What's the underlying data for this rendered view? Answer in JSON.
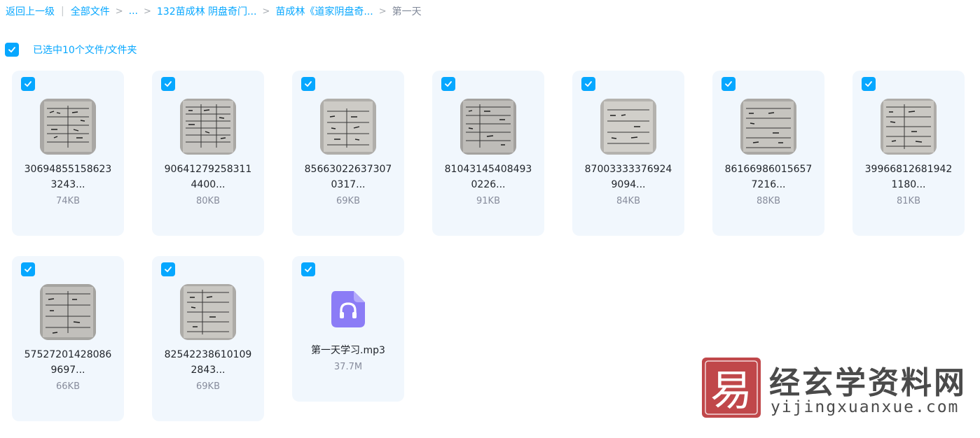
{
  "breadcrumb": {
    "back": "返回上一级",
    "divider": "|",
    "items": [
      "全部文件",
      "...",
      "132苗成林 阴盘奇门...",
      "苗成林《道家阴盘奇..."
    ],
    "separator": ">",
    "current": "第一天"
  },
  "selection": {
    "text": "已选中10个文件/文件夹",
    "checked": true
  },
  "files": [
    {
      "name_line1": "30694855158623",
      "name_line2": "3243...",
      "size": "74KB",
      "type": "image",
      "checked": true
    },
    {
      "name_line1": "90641279258311",
      "name_line2": "4400...",
      "size": "80KB",
      "type": "image",
      "checked": true
    },
    {
      "name_line1": "85663022637307",
      "name_line2": "0317...",
      "size": "69KB",
      "type": "image",
      "checked": true
    },
    {
      "name_line1": "81043145408493",
      "name_line2": "0226...",
      "size": "91KB",
      "type": "image",
      "checked": true
    },
    {
      "name_line1": "87003333376924",
      "name_line2": "9094...",
      "size": "84KB",
      "type": "image",
      "checked": true
    },
    {
      "name_line1": "86166986015657",
      "name_line2": "7216...",
      "size": "88KB",
      "type": "image",
      "checked": true
    },
    {
      "name_line1": "39966812681942",
      "name_line2": "1180...",
      "size": "81KB",
      "type": "image",
      "checked": true
    },
    {
      "name_line1": "57527201428086",
      "name_line2": "9697...",
      "size": "66KB",
      "type": "image",
      "checked": true
    },
    {
      "name_line1": "82542238610109",
      "name_line2": "2843...",
      "size": "69KB",
      "type": "image",
      "checked": true
    },
    {
      "name_line1": "第一天学习.mp3",
      "name_line2": "",
      "size": "37.7M",
      "type": "audio",
      "checked": true
    }
  ],
  "icons": {
    "checkbox": "checkmark-icon",
    "audio": "headphones-icon",
    "thumbnail": "handwritten-notes-photo"
  },
  "colors": {
    "accent": "#06a7ff",
    "card_bg": "#f1f7fd",
    "audio_icon": "#8b7cf6",
    "watermark_logo": "#c0474a"
  },
  "watermark": {
    "logo_glyph": "易",
    "title": "经玄学资料网",
    "domain": "yijingxuanxue.com"
  }
}
